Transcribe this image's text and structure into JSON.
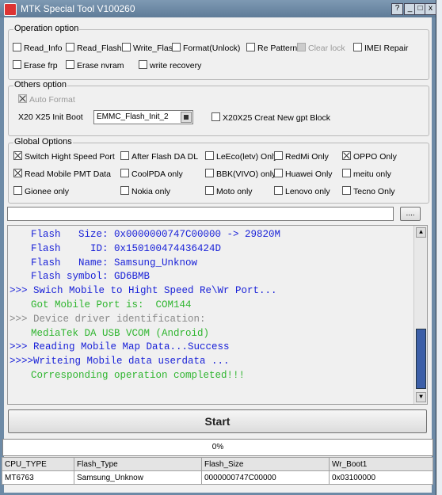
{
  "window": {
    "title": "MTK Special Tool V100260",
    "buttons": [
      "?",
      "_",
      "□",
      "x"
    ]
  },
  "operation": {
    "legend": "Operation option",
    "items": [
      {
        "label": "Read_Info",
        "checked": false
      },
      {
        "label": "Read_Flash",
        "checked": false
      },
      {
        "label": "Write_Flash",
        "checked": false
      },
      {
        "label": "Format(Unlock)",
        "checked": false
      },
      {
        "label": "Re Pattern lo",
        "checked": false
      },
      {
        "label": "Clear lock",
        "checked": false,
        "disabled": true
      },
      {
        "label": "IMEI Repair",
        "checked": false
      },
      {
        "label": "Erase frp",
        "checked": false
      },
      {
        "label": "Erase nvram",
        "checked": false
      },
      {
        "label": "write recovery",
        "checked": false
      }
    ]
  },
  "others": {
    "legend": "Others option",
    "auto_format": "Auto Format",
    "boot_label": "X20 X25 Init Boot",
    "boot_value": "EMMC_Flash_Init_2",
    "gpt_label": "X20X25 Creat New gpt Block"
  },
  "global": {
    "legend": "Global Options",
    "items": [
      {
        "label": "Switch Hight Speed Port",
        "checked": true
      },
      {
        "label": "After Flash DA DL",
        "checked": false
      },
      {
        "label": "LeEco(letv) Only",
        "checked": false
      },
      {
        "label": "RedMi Only",
        "checked": false
      },
      {
        "label": "OPPO Only",
        "checked": true
      },
      {
        "label": "Read Mobile PMT Data",
        "checked": true
      },
      {
        "label": "CoolPDA only",
        "checked": false
      },
      {
        "label": "BBK(VIVO) only",
        "checked": false
      },
      {
        "label": "Huawei Only",
        "checked": false
      },
      {
        "label": "meitu only",
        "checked": false
      },
      {
        "label": "Gionee only",
        "checked": false
      },
      {
        "label": "Nokia only",
        "checked": false
      },
      {
        "label": "Moto only",
        "checked": false
      },
      {
        "label": "Lenovo only",
        "checked": false
      },
      {
        "label": "Tecno Only",
        "checked": false
      }
    ]
  },
  "file": {
    "value": "",
    "browse_label": "...."
  },
  "log": [
    {
      "text": "Flash   Size: 0x0000000747C00000 -> 29820M",
      "color": "#1a22d8"
    },
    {
      "text": "Flash     ID: 0x150100474436424D",
      "color": "#1a22d8"
    },
    {
      "text": "Flash   Name: Samsung_Unknow",
      "color": "#1a22d8"
    },
    {
      "text": "Flash symbol: GD6BMB",
      "color": "#1a22d8"
    },
    {
      "text": ">>> Swich Mobile to Hight Speed Re\\Wr Port...",
      "color": "#1a22d8"
    },
    {
      "text": "Got Mobile Port is:  COM144",
      "color": "#2fb52f"
    },
    {
      "text": ">>> Device driver identification:",
      "color": "#8a8a8a"
    },
    {
      "text": "MediaTek DA USB VCOM (Android)",
      "color": "#2fb52f"
    },
    {
      "text": ">>> Reading Mobile Map Data...Success",
      "color": "#1a22d8"
    },
    {
      "text": ">>>>Writeing Mobile data userdata ...",
      "color": "#1a22d8"
    },
    {
      "text": "Corresponding operation completed!!!",
      "color": "#2fb52f"
    }
  ],
  "start_label": "Start",
  "progress": {
    "text": "0%",
    "value": 0
  },
  "table": {
    "headers": [
      "CPU_TYPE",
      "Flash_Type",
      "Flash_Size",
      "Wr_Boot1"
    ],
    "row": [
      "MT6763",
      "Samsung_Unknow",
      "0000000747C00000",
      "0x03100000"
    ]
  }
}
